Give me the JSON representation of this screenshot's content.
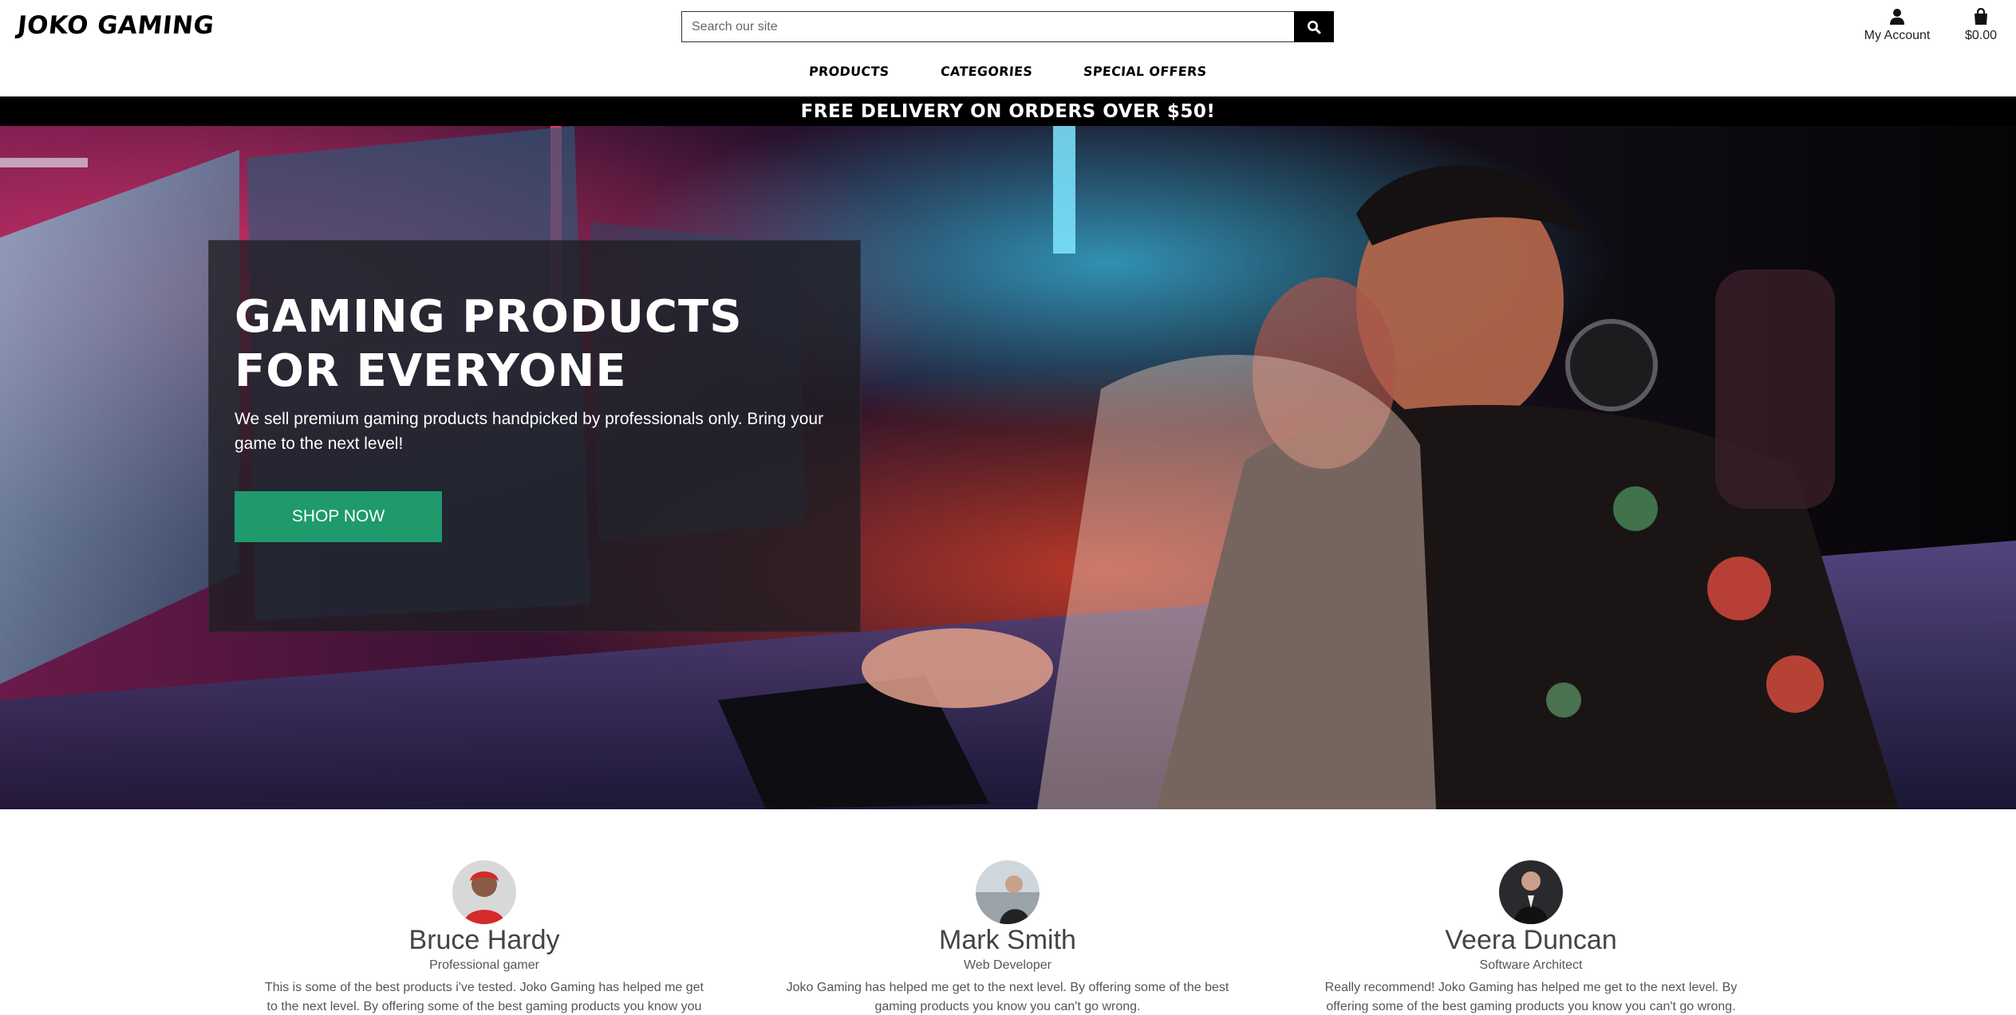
{
  "header": {
    "logo": "JOKO GAMING",
    "search_placeholder": "Search our site",
    "search_icon": "search-icon",
    "account_label": "My Account",
    "account_icon": "user-icon",
    "cart_total": "$0.00",
    "cart_icon": "shopping-bag-icon"
  },
  "nav": {
    "items": [
      {
        "label": "PRODUCTS"
      },
      {
        "label": "CATEGORIES"
      },
      {
        "label": "SPECIAL OFFERS"
      }
    ]
  },
  "banner": {
    "text": "FREE DELIVERY ON ORDERS OVER $50!"
  },
  "hero": {
    "title": "GAMING PRODUCTS FOR EVERYONE",
    "subtitle": "We sell premium gaming products handpicked by professionals only. Bring your game to the next level!",
    "cta_label": "SHOP NOW",
    "cta_color": "#1e9a6c"
  },
  "testimonials": [
    {
      "name": "Bruce Hardy",
      "role": "Professional gamer",
      "quote": "This is some of the best products i've tested. Joko Gaming has helped me get to the next level. By offering some of the best gaming products you know you can't go"
    },
    {
      "name": "Mark Smith",
      "role": "Web Developer",
      "quote": "Joko Gaming has helped me get to the next level. By offering some of the best gaming products you know you can't go wrong."
    },
    {
      "name": "Veera Duncan",
      "role": "Software Architect",
      "quote": "Really recommend! Joko Gaming has helped me get to the next level. By offering some of the best gaming products you know you can't go wrong."
    }
  ]
}
